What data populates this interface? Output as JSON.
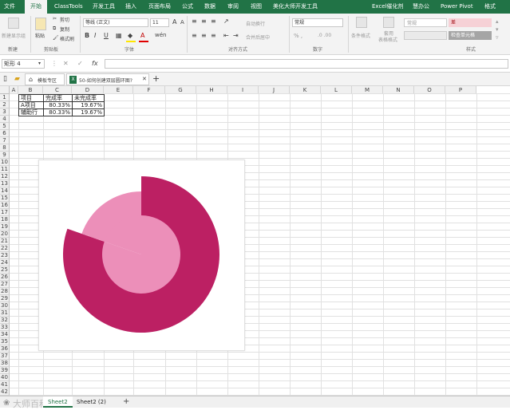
{
  "ribbon_tabs": [
    "文件",
    "开始",
    "ClassTools",
    "开发工具",
    "插入",
    "页面布局",
    "公式",
    "数据",
    "审阅",
    "视图",
    "美化大师",
    "开发工具",
    "Excel催化剂",
    "慧办公",
    "Power Pivot",
    "格式"
  ],
  "ribbon": {
    "new_label": "新建显示组",
    "paste": "粘贴",
    "cut": "剪切",
    "copy": "复制",
    "format_painter": "格式刷",
    "clipboard_group": "剪贴板",
    "font_name": "等线 (正文)",
    "font_size": "11",
    "font_group": "字体",
    "wrap_text": "自动换行",
    "merge_center": "合并后居中",
    "alignment_group": "对齐方式",
    "number_format": "常规",
    "number_group": "数字",
    "conditional_format": "条件格式",
    "format_as_table_line1": "套用",
    "format_as_table_line2": "表格格式",
    "style_normal": "常规",
    "style_bad": "差",
    "style_check": "检查单元格",
    "styles_group": "样式",
    "new_group_label": "新建"
  },
  "formula_bar": {
    "name_box": "矩形 4",
    "fx": "fx",
    "cancel": "✕",
    "enter": "✓",
    "content": ""
  },
  "doc_tabs": {
    "home_tab": "模板专区",
    "file_tab": "50-如何创建双层圆环图?",
    "plus": "+"
  },
  "columns": [
    "A",
    "B",
    "C",
    "D",
    "E",
    "F",
    "G",
    "H",
    "I",
    "J",
    "K",
    "L",
    "M",
    "N",
    "O",
    "P"
  ],
  "rows": [
    "1",
    "2",
    "3",
    "4",
    "5",
    "6",
    "7",
    "8",
    "9",
    "10",
    "11",
    "12",
    "13",
    "14",
    "15",
    "16",
    "17",
    "18",
    "19",
    "20",
    "21",
    "22",
    "23",
    "24",
    "25",
    "26",
    "27",
    "28",
    "29",
    "30",
    "31",
    "32",
    "33",
    "34",
    "35",
    "36",
    "37",
    "38",
    "39",
    "40",
    "41",
    "42"
  ],
  "table": {
    "headers": [
      "项目",
      "完成率",
      "未完成率"
    ],
    "rows": [
      [
        "A项目",
        "80.33%",
        "19.67%"
      ],
      [
        "辅助行",
        "80.33%",
        "19.67%"
      ]
    ]
  },
  "chart_data": {
    "type": "pie",
    "title": "",
    "series": [
      {
        "values": [
          80.33,
          19.67
        ],
        "colors": [
          "#bc2063",
          "#ec8fb9"
        ]
      },
      {
        "values": [
          80.33,
          19.67
        ],
        "colors": [
          "#ec8fb9",
          "#ec8fb9"
        ]
      }
    ]
  },
  "sheet_tabs": [
    "Sheet2",
    "Sheet2 (2)"
  ],
  "sheet_add": "+",
  "watermark": "大师百科",
  "colors": {
    "excel_green": "#217346",
    "dark_pink": "#bc2063",
    "light_pink": "#ec8fb9"
  }
}
